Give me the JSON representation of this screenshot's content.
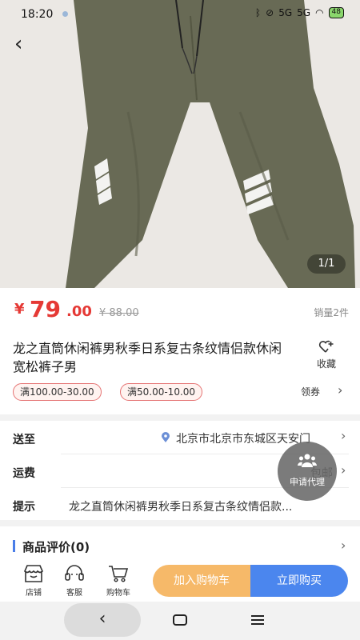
{
  "status_bar": {
    "time": "18:20",
    "signal_1": "5G",
    "signal_2": "5G",
    "battery": "48"
  },
  "hero": {
    "image_counter": "1/1"
  },
  "product": {
    "currency": "¥",
    "price_int": "79",
    "price_dec": ".00",
    "original_price": "¥ 88.00",
    "sales": "销量2件",
    "title": "龙之直筒休闲裤男秋季日系复古条纹情侣款休闲宽松裤子男",
    "favorite_label": "收藏"
  },
  "coupons": {
    "items": [
      "满100.00-30.00",
      "满50.00-10.00"
    ],
    "claim_label": "领券"
  },
  "delivery": {
    "ship_label": "送至",
    "ship_value": "北京市北京市东城区天安门",
    "fee_label": "运费",
    "fee_value": "包邮",
    "tip_label": "提示",
    "tip_value": "龙之直筒休闲裤男秋季日系复古条纹情侣款..."
  },
  "review": {
    "title": "商品评价(0)"
  },
  "agent": {
    "label": "申请代理"
  },
  "actions": {
    "shop": "店铺",
    "service": "客服",
    "cart": "购物车",
    "add_to_cart": "加入购物车",
    "buy_now": "立即购买"
  },
  "colors": {
    "price": "#e53935",
    "add_to_cart": "#f6b969",
    "buy_now": "#4b86ee",
    "pants": "#686a55"
  },
  "icons": [
    "back-icon",
    "heart-plus-icon",
    "location-icon",
    "chevron-right-icon",
    "people-icon",
    "shop-icon",
    "headset-icon",
    "cart-icon",
    "home-nav-icon",
    "menu-nav-icon"
  ]
}
